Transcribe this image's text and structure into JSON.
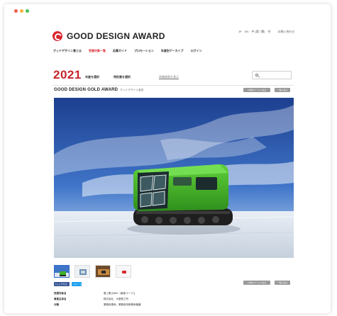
{
  "brand": {
    "name": "GOOD DESIGN AWARD",
    "accent": "#d9262f"
  },
  "header": {
    "lang_links": [
      "JP",
      "EN",
      "中 (简 / 繁)",
      "한"
    ],
    "search_link": "お問い合わせ"
  },
  "nav": {
    "items": [
      {
        "label": "グッドデザイン賞とは",
        "active": false
      },
      {
        "label": "受賞対象一覧",
        "active": true
      },
      {
        "label": "応募ガイド",
        "active": false
      },
      {
        "label": "プロモーション",
        "active": false
      },
      {
        "label": "年度別アーカイブ",
        "active": false
      },
      {
        "label": "ログイン",
        "active": false
      }
    ]
  },
  "filters": {
    "year": "2021",
    "year_select": "年度を選択",
    "award_select": "特別賞を選択",
    "detail_search": "詳細検索を表示"
  },
  "award": {
    "title": "GOOD DESIGN GOLD AWARD",
    "subtitle": "グッドデザイン金賞",
    "prev_button": "＜前のページへ戻る",
    "list_button": "一覧に戻る"
  },
  "social": {
    "facebook": "f シェアする",
    "twitter": "ツイート"
  },
  "info": {
    "rows": [
      {
        "label": "受賞対象名",
        "value": "雪上車 [NAVI（南極コード）]"
      },
      {
        "label": "事業主体名",
        "value": "株式会社　大原鉄工所"
      },
      {
        "label": "分類",
        "value": "業務用車両、業務用特殊車両機器"
      }
    ]
  },
  "thumbnails": {
    "icons": [
      "thumb-vehicle",
      "thumb-interior",
      "thumb-exterior",
      "thumb-logo"
    ]
  }
}
